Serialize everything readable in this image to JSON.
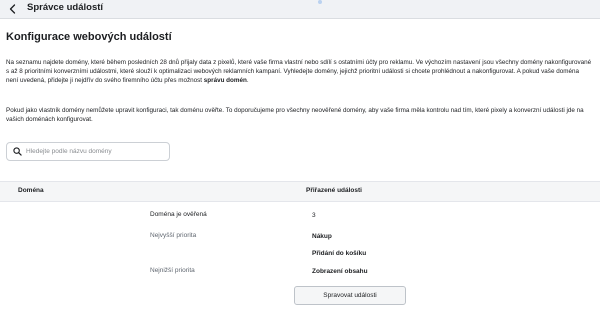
{
  "topbar": {
    "title": "Správce událostí"
  },
  "page": {
    "heading": "Konfigurace webových událostí"
  },
  "intro": {
    "p1_text": "Na seznamu najdete domény, které během posledních 28 dnů přijaly data z pixelů, které vaše firma vlastní nebo sdílí s ostatními účty pro reklamu. Ve výchozím nastavení jsou všechny domény nakonfigurované s až 8 prioritními konverzními událostmi, které slouží k optimalizaci webových reklamních kampaní. Vyhledejte domény, jejichž prioritní události si chcete prohlédnout a nakonfigurovat. A pokud vaše doména není uvedená, přidejte ji nejdřív do svého firemního účtu přes možnost ",
    "p1_link": "správu domén",
    "p1_end": ".",
    "p2_text": "Pokud jako vlastník domény nemůžete upravit konfiguraci, tak doménu ověřte. To doporučujeme pro všechny neověřené domény, aby vaše firma měla kontrolu nad tím, které pixely a konverzní události jde na vašich doménách konfigurovat."
  },
  "search": {
    "placeholder": "Hledejte podle názvu domény",
    "value": ""
  },
  "table": {
    "col_domain": "Doména",
    "col_events": "Přiřazené události",
    "rows": [
      {
        "label": "Doména je ověřená",
        "value": "3"
      },
      {
        "label": "Nejvyšší priorita",
        "value": "Nákup"
      },
      {
        "label": "",
        "value": "Přidání do košíku"
      },
      {
        "label": "Nejnižší priorita",
        "value": "Zobrazení obsahu"
      }
    ],
    "manage_button": "Spravovat události"
  },
  "icons": {
    "back": "chevron-left-icon",
    "search": "magnifier-icon"
  },
  "colors": {
    "topbar_bg": "#f0f2f5",
    "header_bg": "#f5f6f7",
    "text": "#1c1e21",
    "muted": "#606770"
  }
}
